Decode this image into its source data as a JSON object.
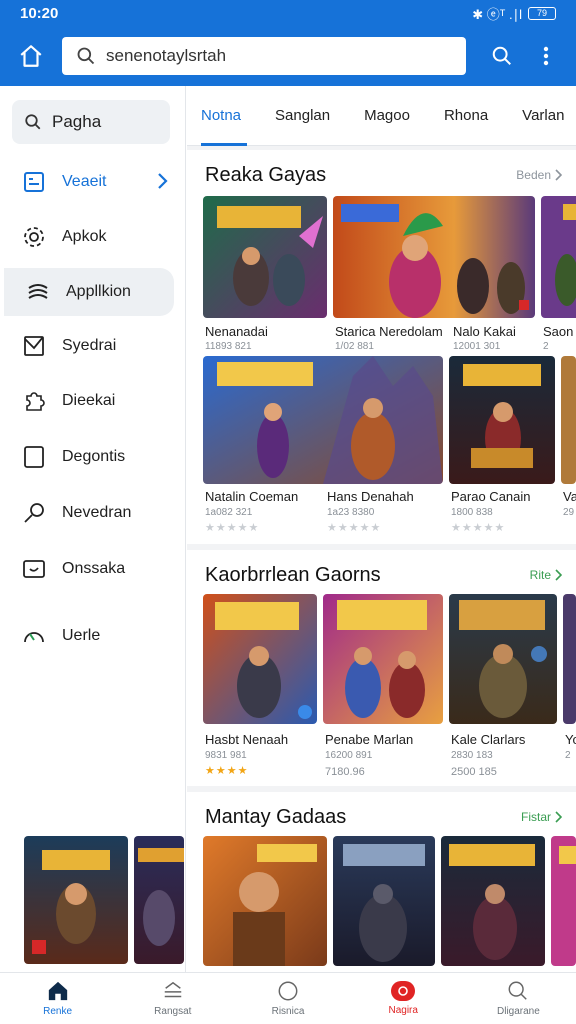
{
  "status_bar": {
    "time": "10:20",
    "indicators": "✱ ⓔᵀ .∣l",
    "battery": "79"
  },
  "app_bar": {
    "search_value": "senenotaylsrtah",
    "icons": [
      "home-icon",
      "search-icon",
      "more-vert-icon"
    ]
  },
  "sidebar": {
    "search_label": "Pagha",
    "items": [
      {
        "label": "Veaeit",
        "icon": "list-icon"
      },
      {
        "label": "Apkok",
        "icon": "gear-icon"
      },
      {
        "label": "Appllkion",
        "icon": "stack-icon"
      },
      {
        "label": "Syedrai",
        "icon": "mail-icon"
      },
      {
        "label": "Dieekai",
        "icon": "puzzle-icon"
      },
      {
        "label": "Degontis",
        "icon": "document-icon"
      },
      {
        "label": "Nevedran",
        "icon": "key-icon"
      },
      {
        "label": "Onssaka",
        "icon": "wallet-icon"
      },
      {
        "label": "Uerle",
        "icon": "gauge-icon"
      }
    ]
  },
  "tabs": [
    "Notna",
    "Sanglan",
    "Magoo",
    "Rhona",
    "Varlan"
  ],
  "sections": [
    {
      "title": "Reaka Gayas",
      "more": "Beden",
      "row1": [
        {
          "title": "Nenanadai",
          "meta": "11893 821"
        },
        {
          "title": "Starica Neredolam",
          "meta": "1/02 881"
        },
        {
          "title": "Nalo Kakai",
          "meta": "12001 301"
        },
        {
          "title": "Saon",
          "meta": "2"
        }
      ],
      "row2": [
        {
          "title": "Natalin Coeman",
          "meta": "1a082 321"
        },
        {
          "title": "Hans Denahah",
          "meta": "1a23 8380"
        },
        {
          "title": "Parao Canain",
          "meta": "1800 838"
        },
        {
          "title": "Va",
          "meta": "29"
        }
      ]
    },
    {
      "title": "Kaorbrrlean Gaorns",
      "more": "Rite",
      "row": [
        {
          "title": "Hasbt Nenaah",
          "meta": "9831 981"
        },
        {
          "title": "Penabe Marlan",
          "meta": "16200 891"
        },
        {
          "title": "Kale Clarlars",
          "meta": "2830 183"
        },
        {
          "title": "Yo",
          "meta": "2"
        }
      ],
      "extra": [
        "7180.96",
        "2500 185"
      ]
    },
    {
      "title": "Mantay Gadaas",
      "more": "Fistar"
    }
  ],
  "bottom_nav": [
    {
      "label": "Renke",
      "icon": "home-icon"
    },
    {
      "label": "Rangsat",
      "icon": "menu-icon"
    },
    {
      "label": "Risnica",
      "icon": "circle-icon"
    },
    {
      "label": "Nagira",
      "icon": "badge-icon"
    },
    {
      "label": "Dligarane",
      "icon": "search-icon"
    }
  ],
  "colors": {
    "accent": "#1672d8",
    "hot": "#e02424",
    "star": "#f2a515",
    "link_green": "#3a9d52"
  }
}
